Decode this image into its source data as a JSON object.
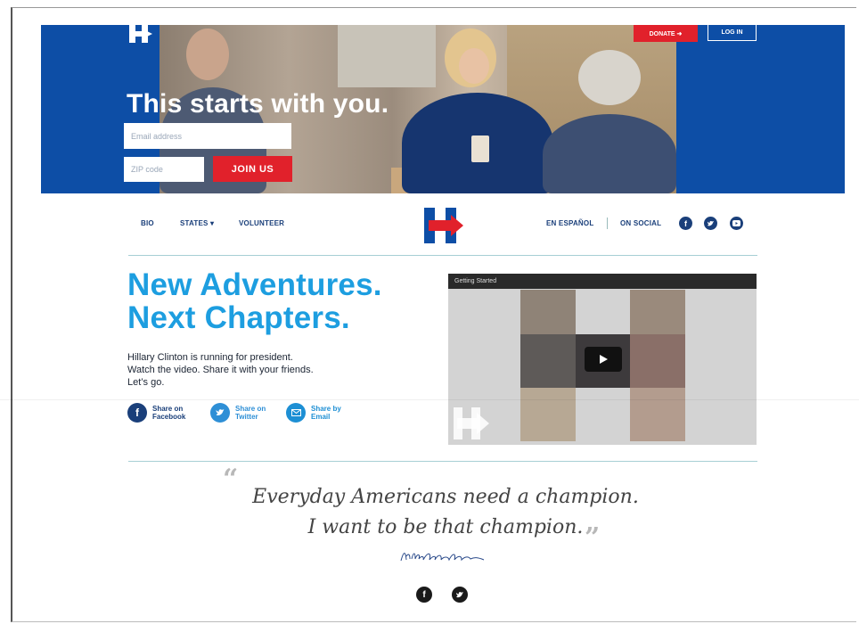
{
  "header": {
    "donate_label": "DONATE ➜",
    "login_label": "LOG IN"
  },
  "hero": {
    "title": "This starts with you.",
    "email_placeholder": "Email address",
    "zip_placeholder": "ZIP code",
    "join_label": "JOIN US"
  },
  "nav": {
    "bio": "BIO",
    "states": "STATES ▾",
    "volunteer": "VOLUNTEER",
    "espanol": "EN ESPAÑOL",
    "on_social": "ON SOCIAL",
    "social_icons": [
      "facebook-icon",
      "twitter-icon",
      "youtube-icon"
    ]
  },
  "main": {
    "headline_1": "New Adventures.",
    "headline_2": "Next Chapters.",
    "desc_1": "Hillary Clinton is running for president.",
    "desc_2": "Watch the video. Share it with your friends.",
    "desc_3": "Let’s go.",
    "share": {
      "facebook": "Share on Facebook",
      "twitter": "Share on Twitter",
      "email": "Share by Email"
    }
  },
  "video": {
    "title": "Getting Started"
  },
  "quote": {
    "line_1": "Everyday Americans need a champion.",
    "line_2": "I want to be that champion.",
    "open_mark": "“",
    "close_mark": "”"
  },
  "colors": {
    "brand_blue": "#0d4ea6",
    "brand_red": "#e1212b",
    "headline_blue": "#1d9ee0",
    "nav_blue": "#1a3f7a"
  }
}
